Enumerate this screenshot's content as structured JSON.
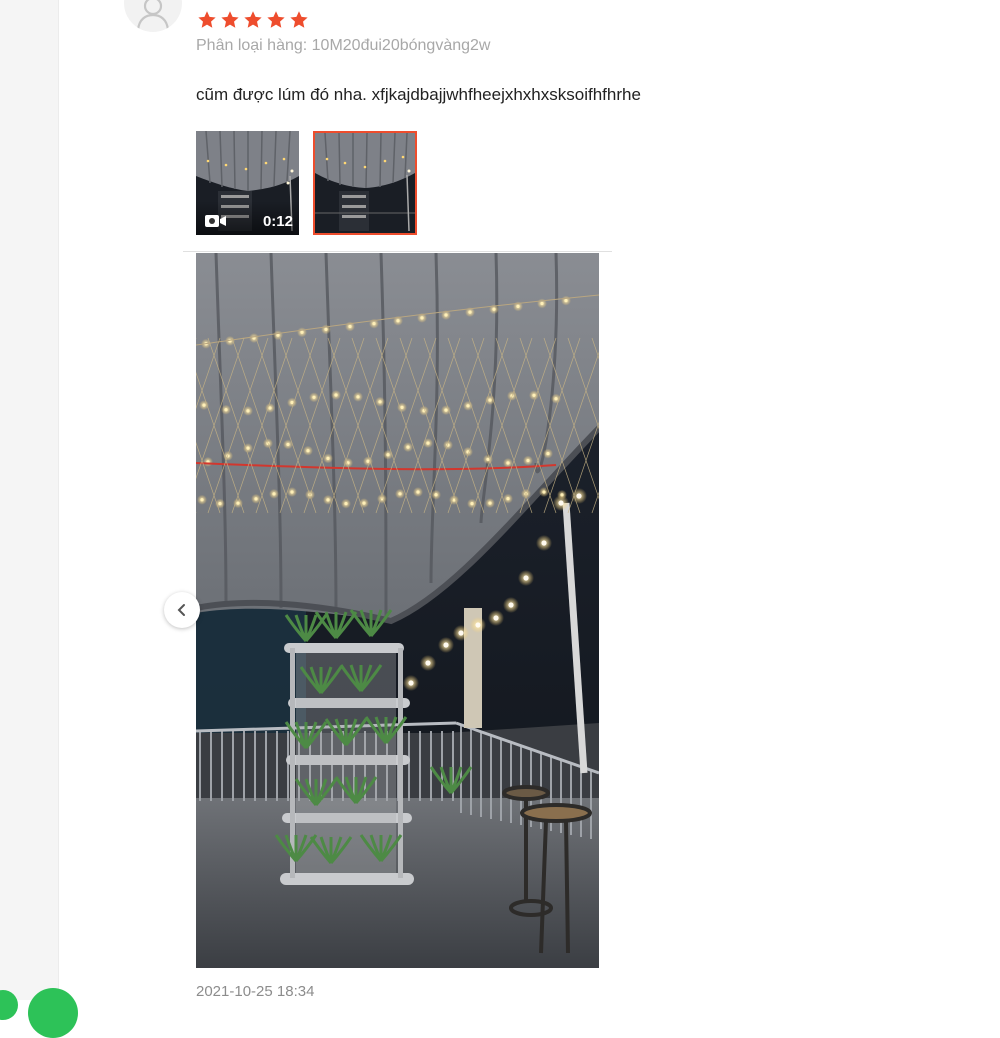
{
  "review": {
    "rating": 5,
    "variation": "Phân loại hàng: 10M20đui20bóngvàng2w",
    "comment": "cũm được lúm đó nha. xfjkajdbajjwhfheejxhxhxsksoifhfhrhe",
    "video_duration": "0:12",
    "timestamp": "2021-10-25 18:34",
    "star_color": "#ee4d2d",
    "selected_border_color": "#ee4d2d"
  },
  "icons": {
    "avatar": "user-avatar-icon",
    "star": "star-icon",
    "video": "video-camera-icon",
    "prev": "chevron-left-icon"
  }
}
